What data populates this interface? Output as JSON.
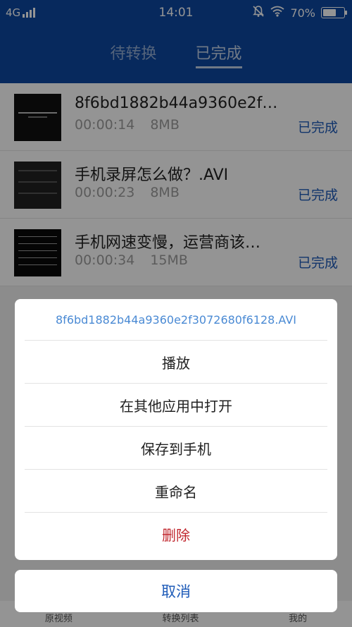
{
  "status_bar": {
    "network": "4G",
    "time": "14:01",
    "battery": "70%",
    "battery_level": 0.7
  },
  "tabs": [
    {
      "label": "待转换",
      "active": false
    },
    {
      "label": "已完成",
      "active": true
    }
  ],
  "files": [
    {
      "title": "8f6bd1882b44a9360e2f…",
      "duration": "00:00:14",
      "size": "8MB",
      "status": "已完成"
    },
    {
      "title": "手机录屏怎么做？.AVI",
      "duration": "00:00:23",
      "size": "8MB",
      "status": "已完成"
    },
    {
      "title": "手机网速变慢，运营商该…",
      "duration": "00:00:34",
      "size": "15MB",
      "status": "已完成"
    }
  ],
  "bottom_nav": [
    "原视频",
    "转换列表",
    "我的"
  ],
  "action_sheet": {
    "title": "8f6bd1882b44a9360e2f3072680f6128.AVI",
    "play": "播放",
    "open_other": "在其他应用中打开",
    "save": "保存到手机",
    "rename": "重命名",
    "delete": "删除",
    "cancel": "取消"
  },
  "colors": {
    "header": "#0d47a1",
    "accent": "#1e5bb8",
    "danger": "#c0262d"
  }
}
